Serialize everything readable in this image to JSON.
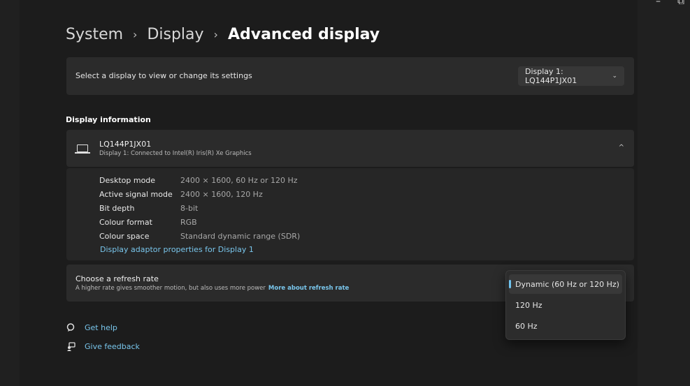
{
  "breadcrumb": {
    "items": [
      "System",
      "Display"
    ],
    "current": "Advanced display",
    "separator": "›"
  },
  "window_controls": {
    "minimize": "–",
    "restore": "⧉"
  },
  "display_select": {
    "label": "Select a display to view or change its settings",
    "value": "Display 1: LQ144P1JX01",
    "chevron": "⌄"
  },
  "display_info": {
    "section_title": "Display information",
    "name": "LQ144P1JX01",
    "subtitle": "Display 1: Connected to Intel(R) Iris(R) Xe Graphics",
    "rows": [
      {
        "key": "Desktop mode",
        "value": "2400 × 1600, 60 Hz or 120 Hz"
      },
      {
        "key": "Active signal mode",
        "value": "2400 × 1600, 120 Hz"
      },
      {
        "key": "Bit depth",
        "value": "8-bit"
      },
      {
        "key": "Colour format",
        "value": "RGB"
      },
      {
        "key": "Colour space",
        "value": "Standard dynamic range (SDR)"
      }
    ],
    "adaptor_link": "Display adaptor properties for Display 1"
  },
  "refresh_rate": {
    "title": "Choose a refresh rate",
    "description": "A higher rate gives smoother motion, but also uses more power",
    "more_link": "More about refresh rate",
    "options": [
      "Dynamic (60 Hz or 120 Hz)",
      "120 Hz",
      "60 Hz"
    ],
    "selected": "Dynamic (60 Hz or 120 Hz)"
  },
  "help": {
    "get_help": "Get help",
    "give_feedback": "Give feedback"
  },
  "colors": {
    "background": "#1c1c1c",
    "card": "#2b2b2b",
    "link": "#79c6ec",
    "accent": "#6fc3ef"
  }
}
